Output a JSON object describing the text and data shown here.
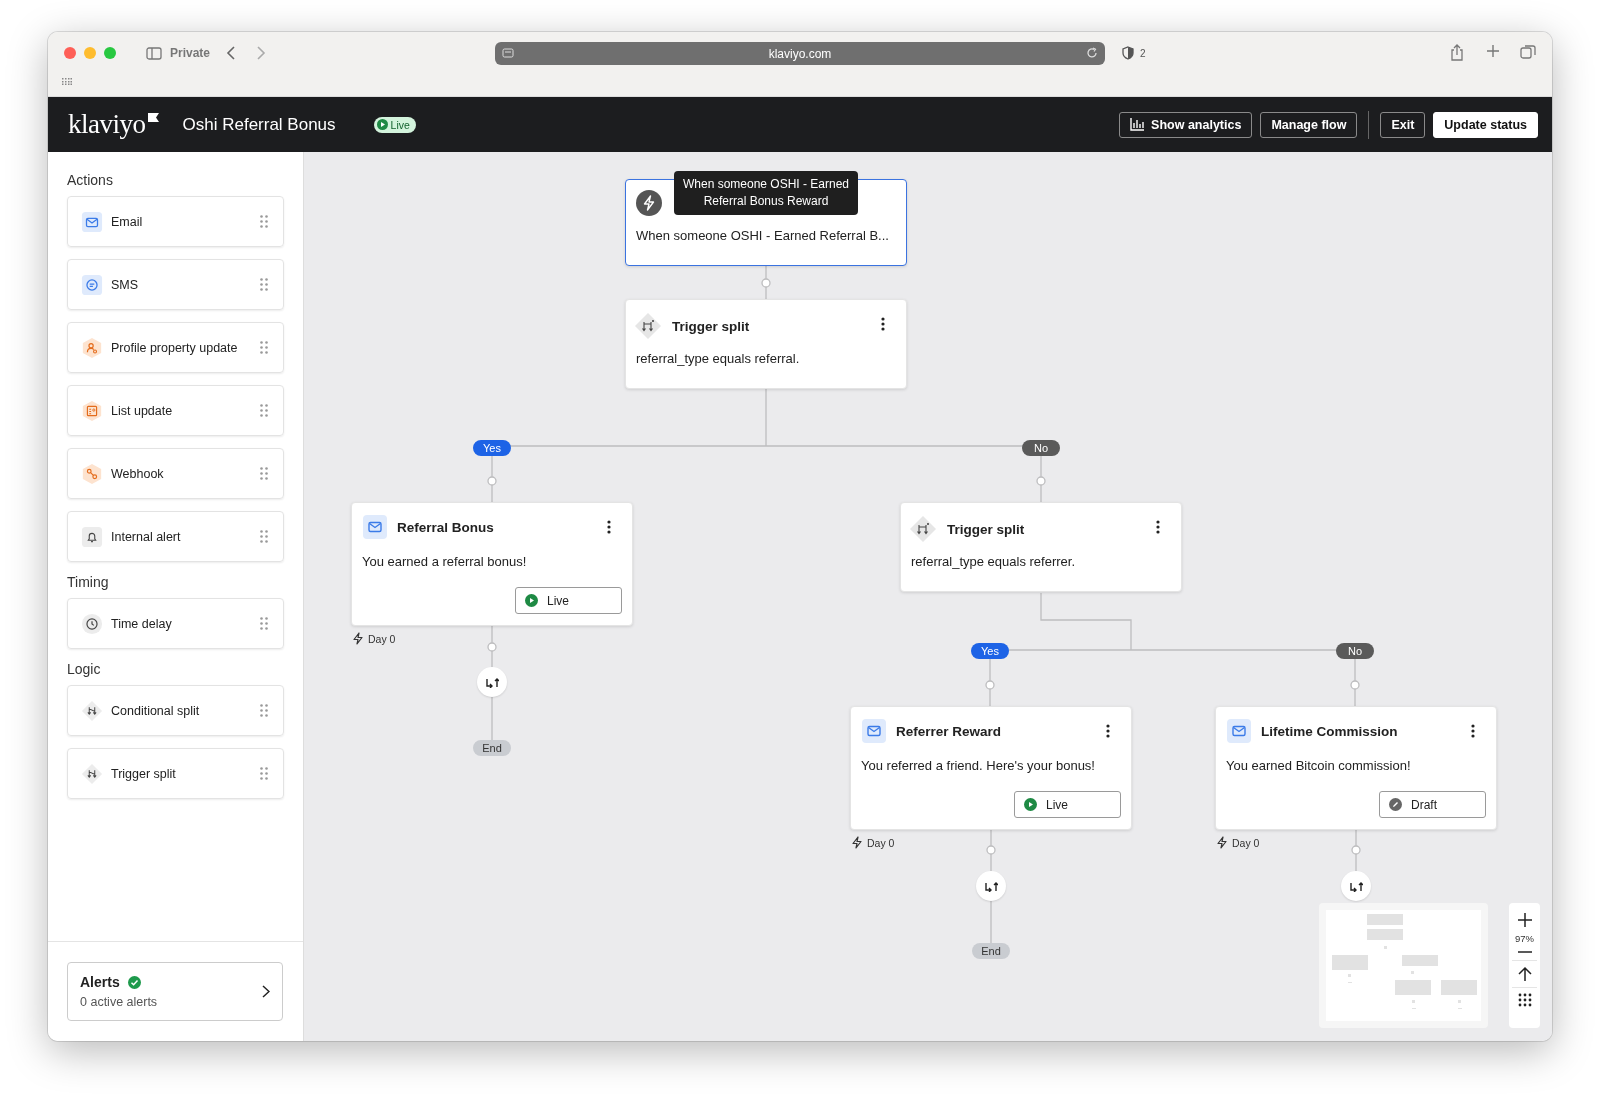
{
  "browser": {
    "private_label": "Private",
    "url": "klaviyo.com",
    "shield_count": "2"
  },
  "header": {
    "logo": "klaviyo",
    "title": "Oshi Referral Bonus",
    "status": "Live",
    "buttons": [
      {
        "label": "Show analytics",
        "kind": "analytics"
      },
      {
        "label": "Manage flow",
        "kind": "outline"
      },
      {
        "label": "Exit",
        "kind": "outline"
      },
      {
        "label": "Update status",
        "kind": "primary"
      }
    ]
  },
  "sidebar": {
    "sections": [
      {
        "title": "Actions",
        "items": [
          {
            "label": "Email",
            "kind": "email"
          },
          {
            "label": "SMS",
            "kind": "sms"
          },
          {
            "label": "Profile property update",
            "kind": "profile"
          },
          {
            "label": "List update",
            "kind": "list"
          },
          {
            "label": "Webhook",
            "kind": "webhook"
          },
          {
            "label": "Internal alert",
            "kind": "alert"
          }
        ]
      },
      {
        "title": "Timing",
        "items": [
          {
            "label": "Time delay",
            "kind": "delay"
          }
        ]
      },
      {
        "title": "Logic",
        "items": [
          {
            "label": "Conditional split",
            "kind": "split"
          },
          {
            "label": "Trigger split",
            "kind": "split"
          }
        ]
      }
    ],
    "alerts": {
      "title": "Alerts",
      "subtitle": "0 active alerts"
    }
  },
  "flow": {
    "trigger": {
      "text": "When someone OSHI - Earned Referral B...",
      "tooltip": "When someone OSHI - Earned Referral Bonus Reward",
      "selected": true
    },
    "splits": [
      {
        "title": "Trigger split",
        "text": "referral_type equals referral."
      },
      {
        "title": "Trigger split",
        "text": "referral_type equals referrer."
      }
    ],
    "branch_labels": [
      {
        "label": "Yes",
        "kind": "yes"
      },
      {
        "label": "No",
        "kind": "no"
      },
      {
        "label": "Yes",
        "kind": "yes"
      },
      {
        "label": "No",
        "kind": "no"
      }
    ],
    "messages": [
      {
        "title": "Referral Bonus",
        "text": "You earned a referral bonus!",
        "status": {
          "label": "Live",
          "kind": "live"
        },
        "delay": "Day 0"
      },
      {
        "title": "Referrer Reward",
        "text": "You referred a friend. Here's your bonus!",
        "status": {
          "label": "Live",
          "kind": "live"
        },
        "delay": "Day 0"
      },
      {
        "title": "Lifetime Commission",
        "text": "You earned Bitcoin commission!",
        "status": {
          "label": "Draft",
          "kind": "draft"
        },
        "delay": "Day 0"
      }
    ],
    "end_labels": [
      "End",
      "End"
    ],
    "zoom": "97%"
  }
}
